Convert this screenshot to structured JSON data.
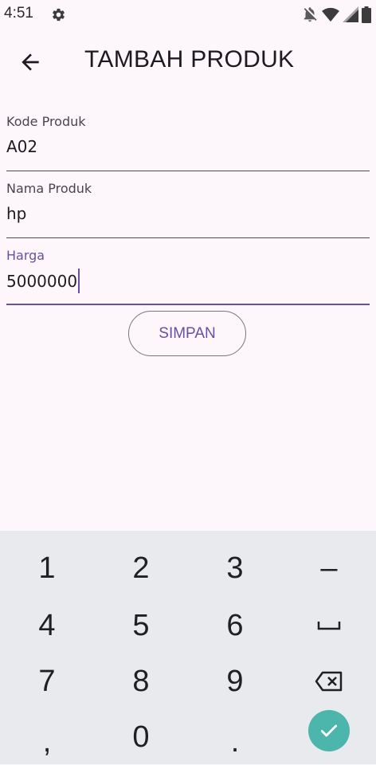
{
  "status_bar": {
    "time": "4:51",
    "icons": [
      "gear-icon",
      "notifications-off-icon",
      "wifi-icon",
      "signal-icon",
      "battery-icon"
    ]
  },
  "app_bar": {
    "back_icon": "arrow-left-icon",
    "title": "TAMBAH PRODUK"
  },
  "form": {
    "fields": [
      {
        "label": "Kode Produk",
        "value": "A02"
      },
      {
        "label": "Nama Produk",
        "value": "hp"
      },
      {
        "label": "Harga",
        "value": "5000000"
      }
    ],
    "submit_label": "SIMPAN"
  },
  "keyboard": {
    "keys": [
      "1",
      "2",
      "3",
      "–",
      "4",
      "5",
      "6",
      "␣",
      "7",
      "8",
      "9",
      "⌫",
      ",",
      "0",
      ".",
      "✓"
    ],
    "special_icons": {
      "space": "space-icon",
      "backspace": "backspace-icon",
      "enter": "check-icon"
    }
  },
  "colors": {
    "background": "#fdf7fc",
    "accent": "#6750a4",
    "keyboard_bg": "#e8eaed",
    "enter_key": "#4db6ac"
  }
}
